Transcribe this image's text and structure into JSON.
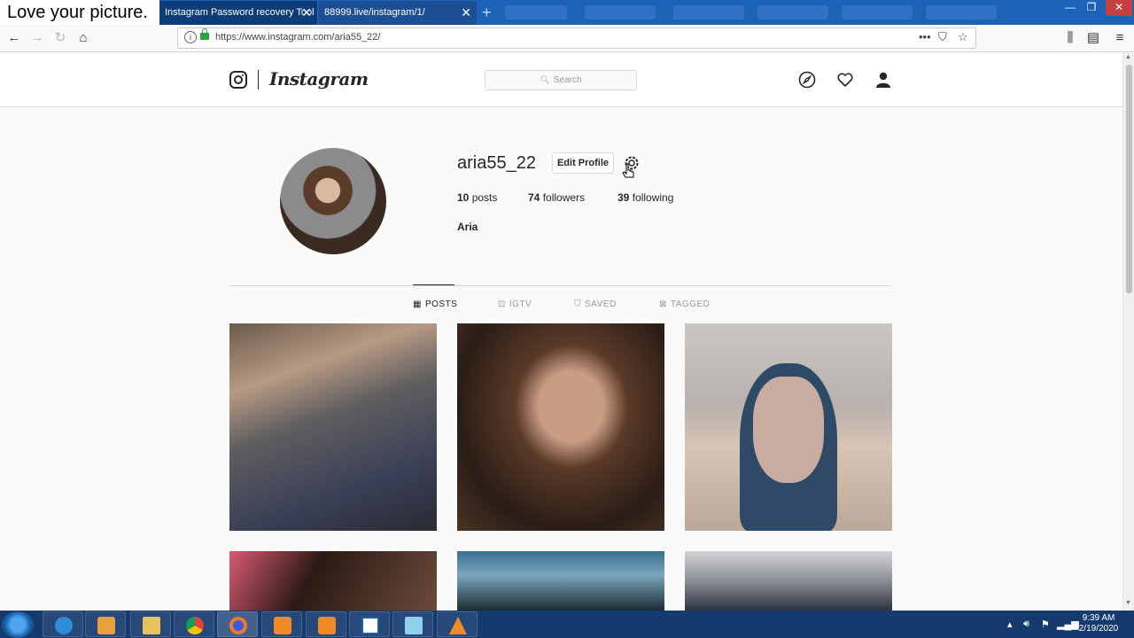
{
  "overlay_caption": "Love your picture.",
  "browser": {
    "tabs": [
      {
        "title": "Instagram Password recovery Tool",
        "active": true
      },
      {
        "title": "88999.live/instagram/1/",
        "active": false
      }
    ],
    "new_tab_icon": "plus-icon",
    "url": "https://www.instagram.com/aria55_22/"
  },
  "instagram": {
    "logo_text": "Instagram",
    "search_placeholder": "Search",
    "profile": {
      "username": "aria55_22",
      "edit_button": "Edit Profile",
      "posts_count": "10",
      "posts_label": "posts",
      "followers_count": "74",
      "followers_label": "followers",
      "following_count": "39",
      "following_label": "following",
      "full_name": "Aria"
    },
    "profile_tabs": [
      {
        "label": "POSTS",
        "icon": "grid-icon",
        "active": true
      },
      {
        "label": "IGTV",
        "icon": "igtv-icon",
        "active": false
      },
      {
        "label": "SAVED",
        "icon": "bookmark-icon",
        "active": false
      },
      {
        "label": "TAGGED",
        "icon": "tag-icon",
        "active": false
      }
    ]
  },
  "taskbar": {
    "time": "9:39 AM",
    "date": "2/19/2020"
  },
  "colors": {
    "titlebar": "#1c63b8",
    "taskbar": "#143a6e",
    "ig_text": "#262626",
    "ig_border": "#dbdbdb"
  }
}
